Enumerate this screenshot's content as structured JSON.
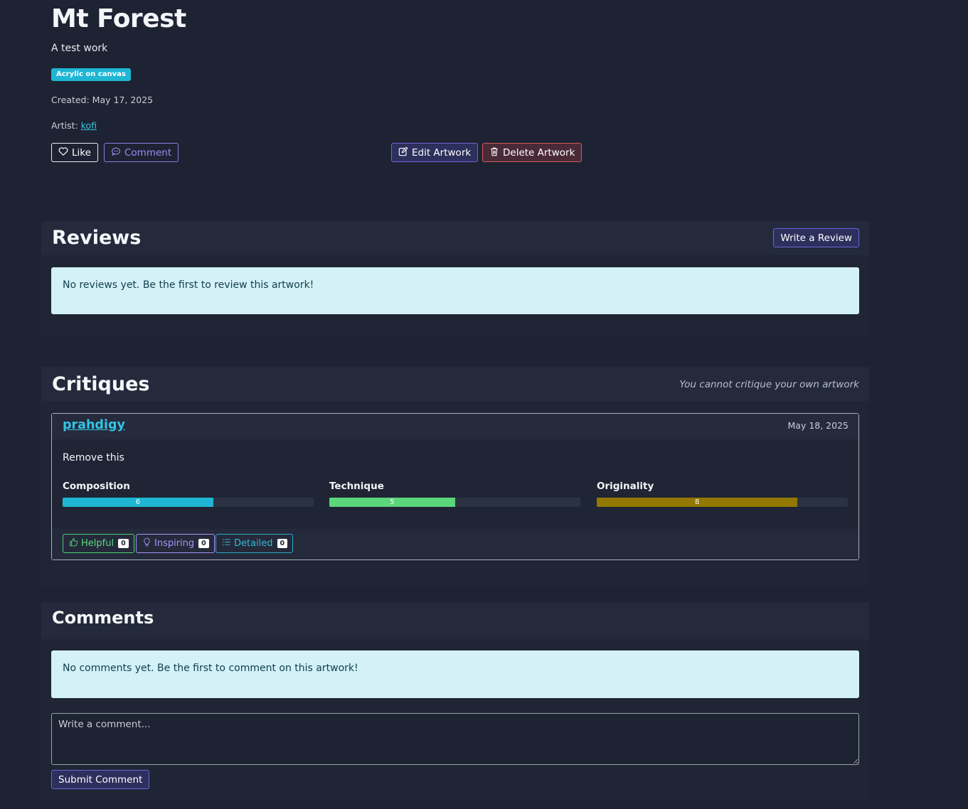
{
  "artwork": {
    "title": "Mt Forest",
    "description": "A test work",
    "medium_badge": "Acrylic on canvas",
    "created": "Created: May 17, 2025",
    "artist_label": "Artist:",
    "artist_name": "kofi"
  },
  "actions": {
    "like": "Like",
    "comment": "Comment",
    "edit": "Edit Artwork",
    "delete": "Delete Artwork"
  },
  "reviews": {
    "title": "Reviews",
    "write_button": "Write a Review",
    "empty_message": "No reviews yet. Be the first to review this artwork!"
  },
  "critiques": {
    "title": "Critiques",
    "notice": "You cannot critique your own artwork",
    "items": [
      {
        "user": "prahdigy",
        "date": "May 18, 2025",
        "body": "Remove this",
        "metrics": [
          {
            "label": "Composition",
            "score": "6",
            "fraction": 0.6,
            "color": "#1fb6d4"
          },
          {
            "label": "Technique",
            "score": "5",
            "fraction": 0.5,
            "color": "#5cd67a"
          },
          {
            "label": "Originality",
            "score": "8",
            "fraction": 0.8,
            "color": "#927700"
          }
        ],
        "reactions": {
          "helpful": {
            "label": "Helpful",
            "count": "0"
          },
          "inspiring": {
            "label": "Inspiring",
            "count": "0"
          },
          "detailed": {
            "label": "Detailed",
            "count": "0"
          }
        }
      }
    ]
  },
  "comments": {
    "title": "Comments",
    "empty_message": "No comments yet. Be the first to comment on this artwork!",
    "placeholder": "Write a comment...",
    "submit": "Submit Comment"
  },
  "icons": {
    "like": "heart-icon",
    "comment": "chat-bubble-icon",
    "edit": "edit-icon",
    "delete": "trash-icon",
    "helpful": "thumbs-up-icon",
    "inspiring": "lightbulb-icon",
    "detailed": "list-icon"
  }
}
